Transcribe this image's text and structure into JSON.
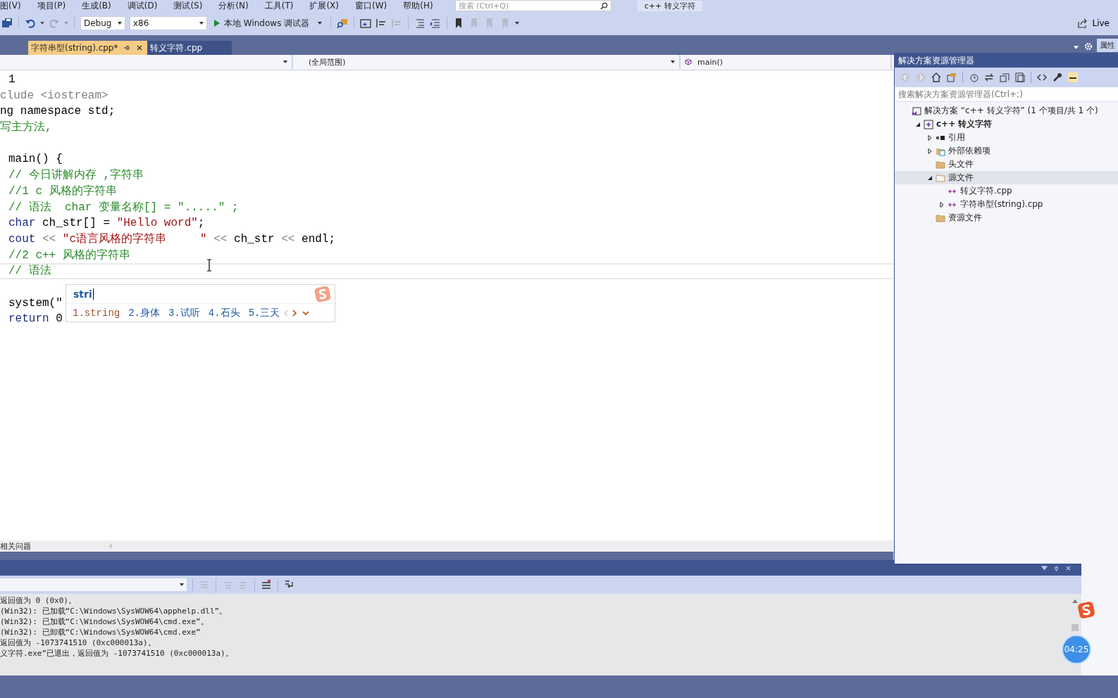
{
  "menu": [
    "图(V)",
    "项目(P)",
    "生成(B)",
    "调试(D)",
    "测试(S)",
    "分析(N)",
    "工具(T)",
    "扩展(X)",
    "窗口(W)",
    "帮助(H)"
  ],
  "search": {
    "placeholder": "搜索 (Ctrl+Q)"
  },
  "solution_title": "c++ 转义字符",
  "toolbar": {
    "configuration": "Debug",
    "platform": "x86",
    "run_button": "本地 Windows 调试器",
    "live_share": "Live"
  },
  "tabs": [
    {
      "label": "字符串型(string).cpp*",
      "selected": true
    },
    {
      "label": "转义字符.cpp",
      "selected": false
    }
  ],
  "side_tab": "属性",
  "nav": {
    "scope": "(全局范围)",
    "member": "main()"
  },
  "code_lines": [
    {
      "indent": true,
      "current": false,
      "segments": [
        {
          "kind": "plain",
          "t": "1"
        }
      ]
    },
    {
      "indent": false,
      "current": false,
      "segments": [
        {
          "kind": "pre",
          "t": "clude "
        },
        {
          "kind": "pre",
          "t": "<iostream>"
        }
      ]
    },
    {
      "indent": false,
      "current": false,
      "segments": [
        {
          "kind": "plain",
          "t": "ng namespace std;"
        }
      ]
    },
    {
      "indent": false,
      "current": false,
      "segments": [
        {
          "kind": "cmt",
          "t": "写主方法,"
        }
      ]
    },
    {
      "current": false
    },
    {
      "indent": true,
      "current": false,
      "segments": [
        {
          "kind": "plain",
          "t": "main() {"
        }
      ]
    },
    {
      "indent": true,
      "current": false,
      "segments": [
        {
          "kind": "cmt",
          "t": "// 今日讲解内存 ,字符串"
        }
      ]
    },
    {
      "indent": true,
      "current": false,
      "segments": [
        {
          "kind": "cmt",
          "t": "//1 c 风格的字符串"
        }
      ]
    },
    {
      "indent": true,
      "current": false,
      "segments": [
        {
          "kind": "cmt",
          "t": "// 语法  char 变量名称[] = \".....\" ;"
        }
      ]
    },
    {
      "indent": true,
      "current": false,
      "segments": [
        {
          "kind": "kw",
          "t": "char"
        },
        {
          "kind": "plain",
          "t": " ch_str[] = "
        },
        {
          "kind": "str",
          "t": "\"Hello word\""
        },
        {
          "kind": "plain",
          "t": ";"
        }
      ]
    },
    {
      "indent": true,
      "current": false,
      "segments": [
        {
          "kind": "kw",
          "t": "cout"
        },
        {
          "kind": "op",
          "t": " << "
        },
        {
          "kind": "str",
          "t": "\"c语言风格的字符串     \""
        },
        {
          "kind": "op",
          "t": " << "
        },
        {
          "kind": "plain",
          "t": "ch_str"
        },
        {
          "kind": "op",
          "t": " << "
        },
        {
          "kind": "plain",
          "t": "endl;"
        }
      ]
    },
    {
      "indent": true,
      "current": false,
      "segments": [
        {
          "kind": "cmt",
          "t": "//2 c++ 风格的字符串"
        }
      ]
    },
    {
      "indent": true,
      "current": true,
      "segments": [
        {
          "kind": "cmt",
          "t": "// 语法"
        }
      ]
    },
    {
      "current": false
    },
    {
      "indent": true,
      "current": false,
      "segments": [
        {
          "kind": "plain",
          "t": "system(\""
        }
      ]
    },
    {
      "indent": true,
      "current": false,
      "segments": [
        {
          "kind": "kw",
          "t": "return"
        },
        {
          "kind": "plain",
          "t": " 0"
        }
      ]
    }
  ],
  "ime": {
    "input": "stri",
    "candidates": [
      {
        "label": "1.string",
        "selected": true
      },
      {
        "label": "2.身体",
        "selected": false
      },
      {
        "label": "3.试听",
        "selected": false
      },
      {
        "label": "4.石头",
        "selected": false
      },
      {
        "label": "5.三天",
        "selected": false
      }
    ]
  },
  "solution_explorer": {
    "title": "解决方案资源管理器",
    "search_placeholder": "搜索解决方案资源管理器(Ctrl+;)",
    "tree": [
      {
        "label": "解决方案 “c++ 转义字符” (1 个项目/共 1 个)",
        "kind": "solution",
        "selected": false,
        "children": [
          {
            "label": "c++ 转义字符",
            "kind": "project",
            "expanded": true,
            "selected": false,
            "children": [
              {
                "label": "引用",
                "kind": "references",
                "expanded": false,
                "selected": false
              },
              {
                "label": "外部依赖项",
                "kind": "external",
                "expanded": false,
                "selected": false
              },
              {
                "label": "头文件",
                "kind": "folder",
                "selected": false
              },
              {
                "label": "源文件",
                "kind": "folder",
                "expanded": true,
                "selected": true,
                "children": [
                  {
                    "label": "转义字符.cpp",
                    "kind": "file",
                    "selected": false
                  },
                  {
                    "label": "字符串型(string).cpp",
                    "kind": "file",
                    "expanded": false,
                    "selected": false
                  }
                ]
              },
              {
                "label": "资源文件",
                "kind": "folder",
                "selected": false
              }
            ]
          }
        ]
      }
    ]
  },
  "error_list_tab": "相关问题",
  "output_lines": [
    "返回值为 0 (0x0)。",
    "(Win32): 已加载“C:\\Windows\\SysWOW64\\apphelp.dll”。",
    "(Win32): 已加载“C:\\Windows\\SysWOW64\\cmd.exe”。",
    "(Win32): 已卸载“C:\\Windows\\SysWOW64\\cmd.exe”",
    "返回值为 -1073741510 (0xc000013a)。",
    "义字符.exe”已退出，返回值为 -1073741510 (0xc000013a)。"
  ],
  "timer": "04:25"
}
